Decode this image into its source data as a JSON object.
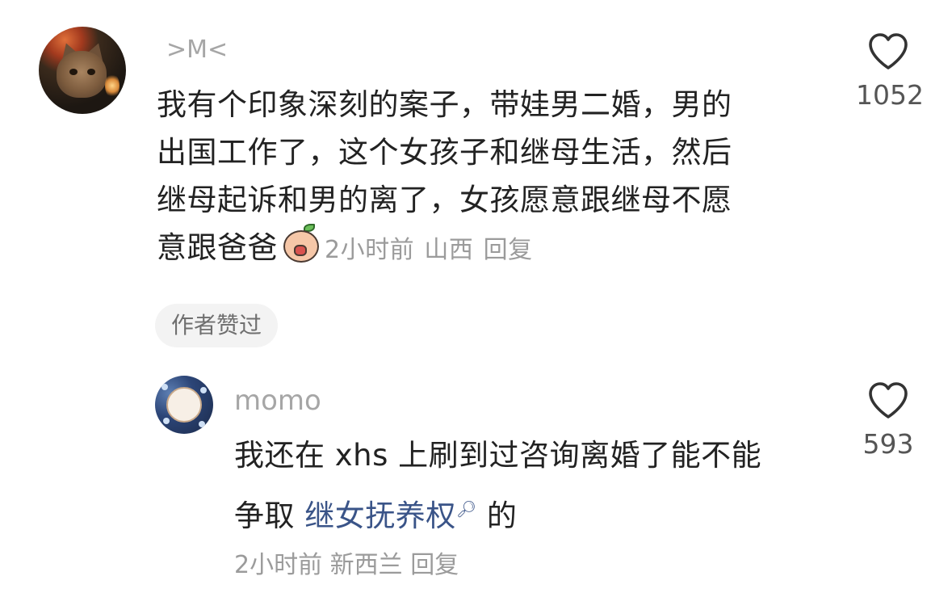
{
  "comments": [
    {
      "username": ">M<",
      "text": "我有个印象深刻的案子，带娃男二婚，男的出国工作了，这个女孩子和继母生活，然后继母起诉和男的离了，女孩愿意跟继母不愿意跟爸爸",
      "line1": "我有个印象深刻的案子，带娃男二婚，男的",
      "line2": "出国工作了，这个女孩子和继母生活，然后",
      "line3": "继母起诉和男的离了，女孩愿意跟继母不愿",
      "line4": "意跟爸爸",
      "time": "2小时前",
      "location": "山西",
      "reply_label": "回复",
      "badge": "作者赞过",
      "likes": "1052",
      "emoji": "crying-face-emoji"
    }
  ],
  "reply": {
    "username": "momo",
    "line1": "我还在 xhs 上刷到过咨询离婚了能不能",
    "line2_prefix": "争取",
    "link_text": "继女抚养权",
    "line2_suffix": "的",
    "time": "2小时前",
    "location": "新西兰",
    "reply_label": "回复",
    "likes": "593"
  },
  "colors": {
    "text": "#222222",
    "meta": "#9b9b9b",
    "link": "#3a5488",
    "badge_bg": "#f3f3f3"
  }
}
